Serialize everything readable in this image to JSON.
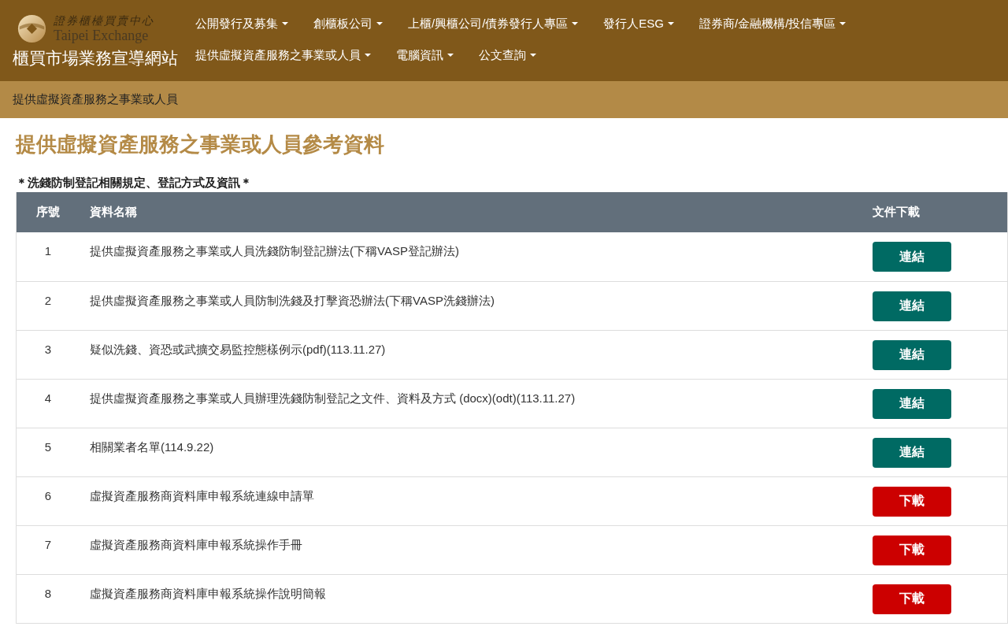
{
  "header": {
    "logo": {
      "chinese_name": "證券櫃檯買賣中心",
      "english_name": "Taipei Exchange"
    },
    "site_title": "櫃買市場業務宣導網站",
    "menu": [
      "公開發行及募集",
      "創櫃板公司",
      "上櫃/興櫃公司/債券發行人專區",
      "發行人ESG",
      "證券商/金融機構/投信專區",
      "提供虛擬資產服務之事業或人員",
      "電腦資訊",
      "公文查詢"
    ]
  },
  "breadcrumb": "提供虛擬資產服務之事業或人員",
  "page_title": "提供虛擬資產服務之事業或人員參考資料",
  "section_title": "＊洗錢防制登記相關規定、登記方式及資訊＊",
  "table": {
    "columns": [
      "序號",
      "資料名稱",
      "文件下載"
    ],
    "rows": [
      {
        "number": "1",
        "name": "提供虛擬資產服務之事業或人員洗錢防制登記辦法(下稱VASP登記辦法)",
        "action": {
          "kind": "link",
          "label": "連結"
        }
      },
      {
        "number": "2",
        "name": "提供虛擬資產服務之事業或人員防制洗錢及打擊資恐辦法(下稱VASP洗錢辦法)",
        "action": {
          "kind": "link",
          "label": "連結"
        }
      },
      {
        "number": "3",
        "name": "疑似洗錢、資恐或武擴交易監控態樣例示(pdf)(113.11.27)",
        "action": {
          "kind": "link",
          "label": "連結"
        }
      },
      {
        "number": "4",
        "name": "提供虛擬資產服務之事業或人員辦理洗錢防制登記之文件、資料及方式 (docx)(odt)(113.11.27)",
        "action": {
          "kind": "link",
          "label": "連結"
        }
      },
      {
        "number": "5",
        "name": "相關業者名單(114.9.22)",
        "action": {
          "kind": "link",
          "label": "連結"
        }
      },
      {
        "number": "6",
        "name": "虛擬資產服務商資料庫申報系統連線申請單",
        "action": {
          "kind": "download",
          "label": "下載"
        }
      },
      {
        "number": "7",
        "name": "虛擬資產服務商資料庫申報系統操作手冊",
        "action": {
          "kind": "download",
          "label": "下載"
        }
      },
      {
        "number": "8",
        "name": "虛擬資產服務商資料庫申報系統操作說明簡報",
        "action": {
          "kind": "download",
          "label": "下載"
        }
      }
    ]
  }
}
